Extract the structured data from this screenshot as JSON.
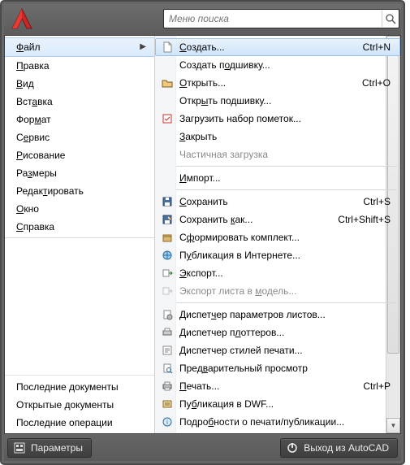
{
  "search": {
    "placeholder": "Меню поиска"
  },
  "leftMenu": [
    {
      "html": "<u>Ф</u>айл",
      "selected": true
    },
    {
      "html": "<u>П</u>равка"
    },
    {
      "html": "<u>В</u>ид"
    },
    {
      "html": "Вст<u>а</u>вка"
    },
    {
      "html": "Фор<u>м</u>ат"
    },
    {
      "html": "С<u>е</u>рвис"
    },
    {
      "html": "<u>Р</u>исование"
    },
    {
      "html": "Ра<u>з</u>меры"
    },
    {
      "html": "Редак<u>т</u>ировать"
    },
    {
      "html": "<u>О</u>кно"
    },
    {
      "html": "<u>С</u>правка"
    }
  ],
  "leftBottom": [
    {
      "label": "Последние документы"
    },
    {
      "label": "Открытые документы"
    },
    {
      "label": "Последние операции"
    }
  ],
  "submenu": [
    {
      "icon": "new-file",
      "html": "<u>С</u>оздать...",
      "shortcut": "Ctrl+N",
      "hl": true
    },
    {
      "icon": "",
      "html": "Создать п<u>о</u>дшивку..."
    },
    {
      "icon": "folder-open",
      "html": "<u>О</u>ткрыть...",
      "shortcut": "Ctrl+O"
    },
    {
      "icon": "",
      "html": "Откр<u>ы</u>ть подшивку..."
    },
    {
      "icon": "markup",
      "html": "Загрузить набор пометок..."
    },
    {
      "icon": "",
      "html": "<u>З</u>акрыть"
    },
    {
      "icon": "",
      "html": "Частичная загрузка",
      "disabled": true
    },
    {
      "sep": true
    },
    {
      "icon": "",
      "html": "<u>И</u>мпорт..."
    },
    {
      "sep": true
    },
    {
      "icon": "save",
      "html": "<u>С</u>охранить",
      "shortcut": "Ctrl+S"
    },
    {
      "icon": "save-as",
      "html": "Сохранить <u>к</u>ак...",
      "shortcut": "Ctrl+Shift+S"
    },
    {
      "icon": "package",
      "html": "С<u>ф</u>ормировать комплект..."
    },
    {
      "icon": "web-publish",
      "html": "П<u>у</u>бликация в Интернете..."
    },
    {
      "icon": "export",
      "html": "<u>Э</u>кспорт..."
    },
    {
      "icon": "export-sheet",
      "html": "Экспорт листа в <u>м</u>одель...",
      "disabled": true
    },
    {
      "sep": true
    },
    {
      "icon": "page-setup",
      "html": "Диспет<u>ч</u>ер параметров листов..."
    },
    {
      "icon": "plotter",
      "html": "Диспетчер п<u>л</u>оттеров..."
    },
    {
      "icon": "styles",
      "html": "Диспетчер стилей печати..."
    },
    {
      "icon": "preview",
      "html": "Пред<u>в</u>арительный просмотр"
    },
    {
      "icon": "print",
      "html": "<u>П</u>ечать...",
      "shortcut": "Ctrl+P"
    },
    {
      "icon": "dwf",
      "html": "Пу<u>б</u>ликация в DWF..."
    },
    {
      "icon": "info",
      "html": "Подро<u>б</u>ности о печати/публикации..."
    }
  ],
  "footer": {
    "params": "Параметры",
    "exit": "Выход из AutoCAD"
  }
}
